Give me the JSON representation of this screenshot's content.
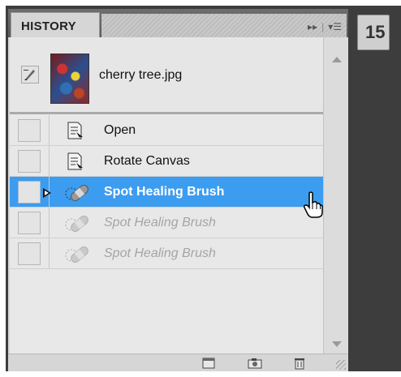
{
  "panel": {
    "tab_label": "HISTORY",
    "menu_icon": "panel-menu-icon",
    "collapse_icon": "double-arrow-icon"
  },
  "snapshot": {
    "name": "cherry tree.jpg",
    "icon": "brush-source-icon"
  },
  "history": [
    {
      "label": "Open",
      "icon": "document-step-icon",
      "state": "normal"
    },
    {
      "label": "Rotate Canvas",
      "icon": "document-step-icon",
      "state": "normal"
    },
    {
      "label": "Spot Healing Brush",
      "icon": "bandage-icon",
      "state": "selected"
    },
    {
      "label": "Spot Healing Brush",
      "icon": "bandage-icon",
      "state": "dimmed"
    },
    {
      "label": "Spot Healing Brush",
      "icon": "bandage-icon",
      "state": "dimmed"
    }
  ],
  "footer": {
    "buttons": [
      "new-document-from-state-icon",
      "camera-snapshot-icon",
      "trash-icon"
    ]
  },
  "dock": {
    "glyph": "15"
  },
  "colors": {
    "selection": "#3c9cf0",
    "panel_bg": "#d6d6d6",
    "frame": "#3d3d3d"
  }
}
